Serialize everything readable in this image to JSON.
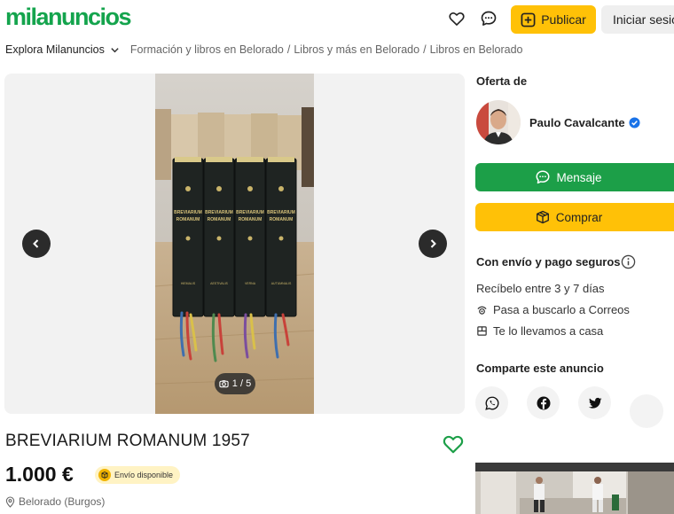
{
  "header": {
    "logo": "milanuncios",
    "publish_label": "Publicar",
    "login_label": "Iniciar sesión"
  },
  "breadcrumb": {
    "explore": "Explora Milanuncios",
    "items": [
      "Formación y libros en Belorado",
      "Libros y más en Belorado",
      "Libros en Belorado"
    ]
  },
  "gallery": {
    "counter": "1 / 5"
  },
  "listing": {
    "title": "BREVIARIUM ROMANUM 1957",
    "price": "1.000 €",
    "shipping_badge": "Envío disponible",
    "location": "Belorado (Burgos)"
  },
  "seller": {
    "heading": "Oferta de",
    "name": "Paulo Cavalcante"
  },
  "actions": {
    "message": "Mensaje",
    "buy": "Comprar"
  },
  "shipping": {
    "heading": "Con envío y pago seguros",
    "eta": "Recíbelo entre 3 y 7 días",
    "option1": "Pasa a buscarlo a Correos",
    "option2": "Te lo llevamos a casa"
  },
  "share": {
    "heading": "Comparte este anuncio"
  },
  "colors": {
    "brand_green": "#14a44d",
    "cta_yellow": "#ffc107",
    "message_green": "#1c9f48",
    "verified_blue": "#1a73e8"
  },
  "book": {
    "spine_title_1": "BREVIARIUM",
    "spine_title_2": "ROMANUM",
    "spine_labels": [
      "HIEMALIS",
      "AESTIVALIS",
      "VERNA",
      "AUTUMNALIS"
    ]
  }
}
